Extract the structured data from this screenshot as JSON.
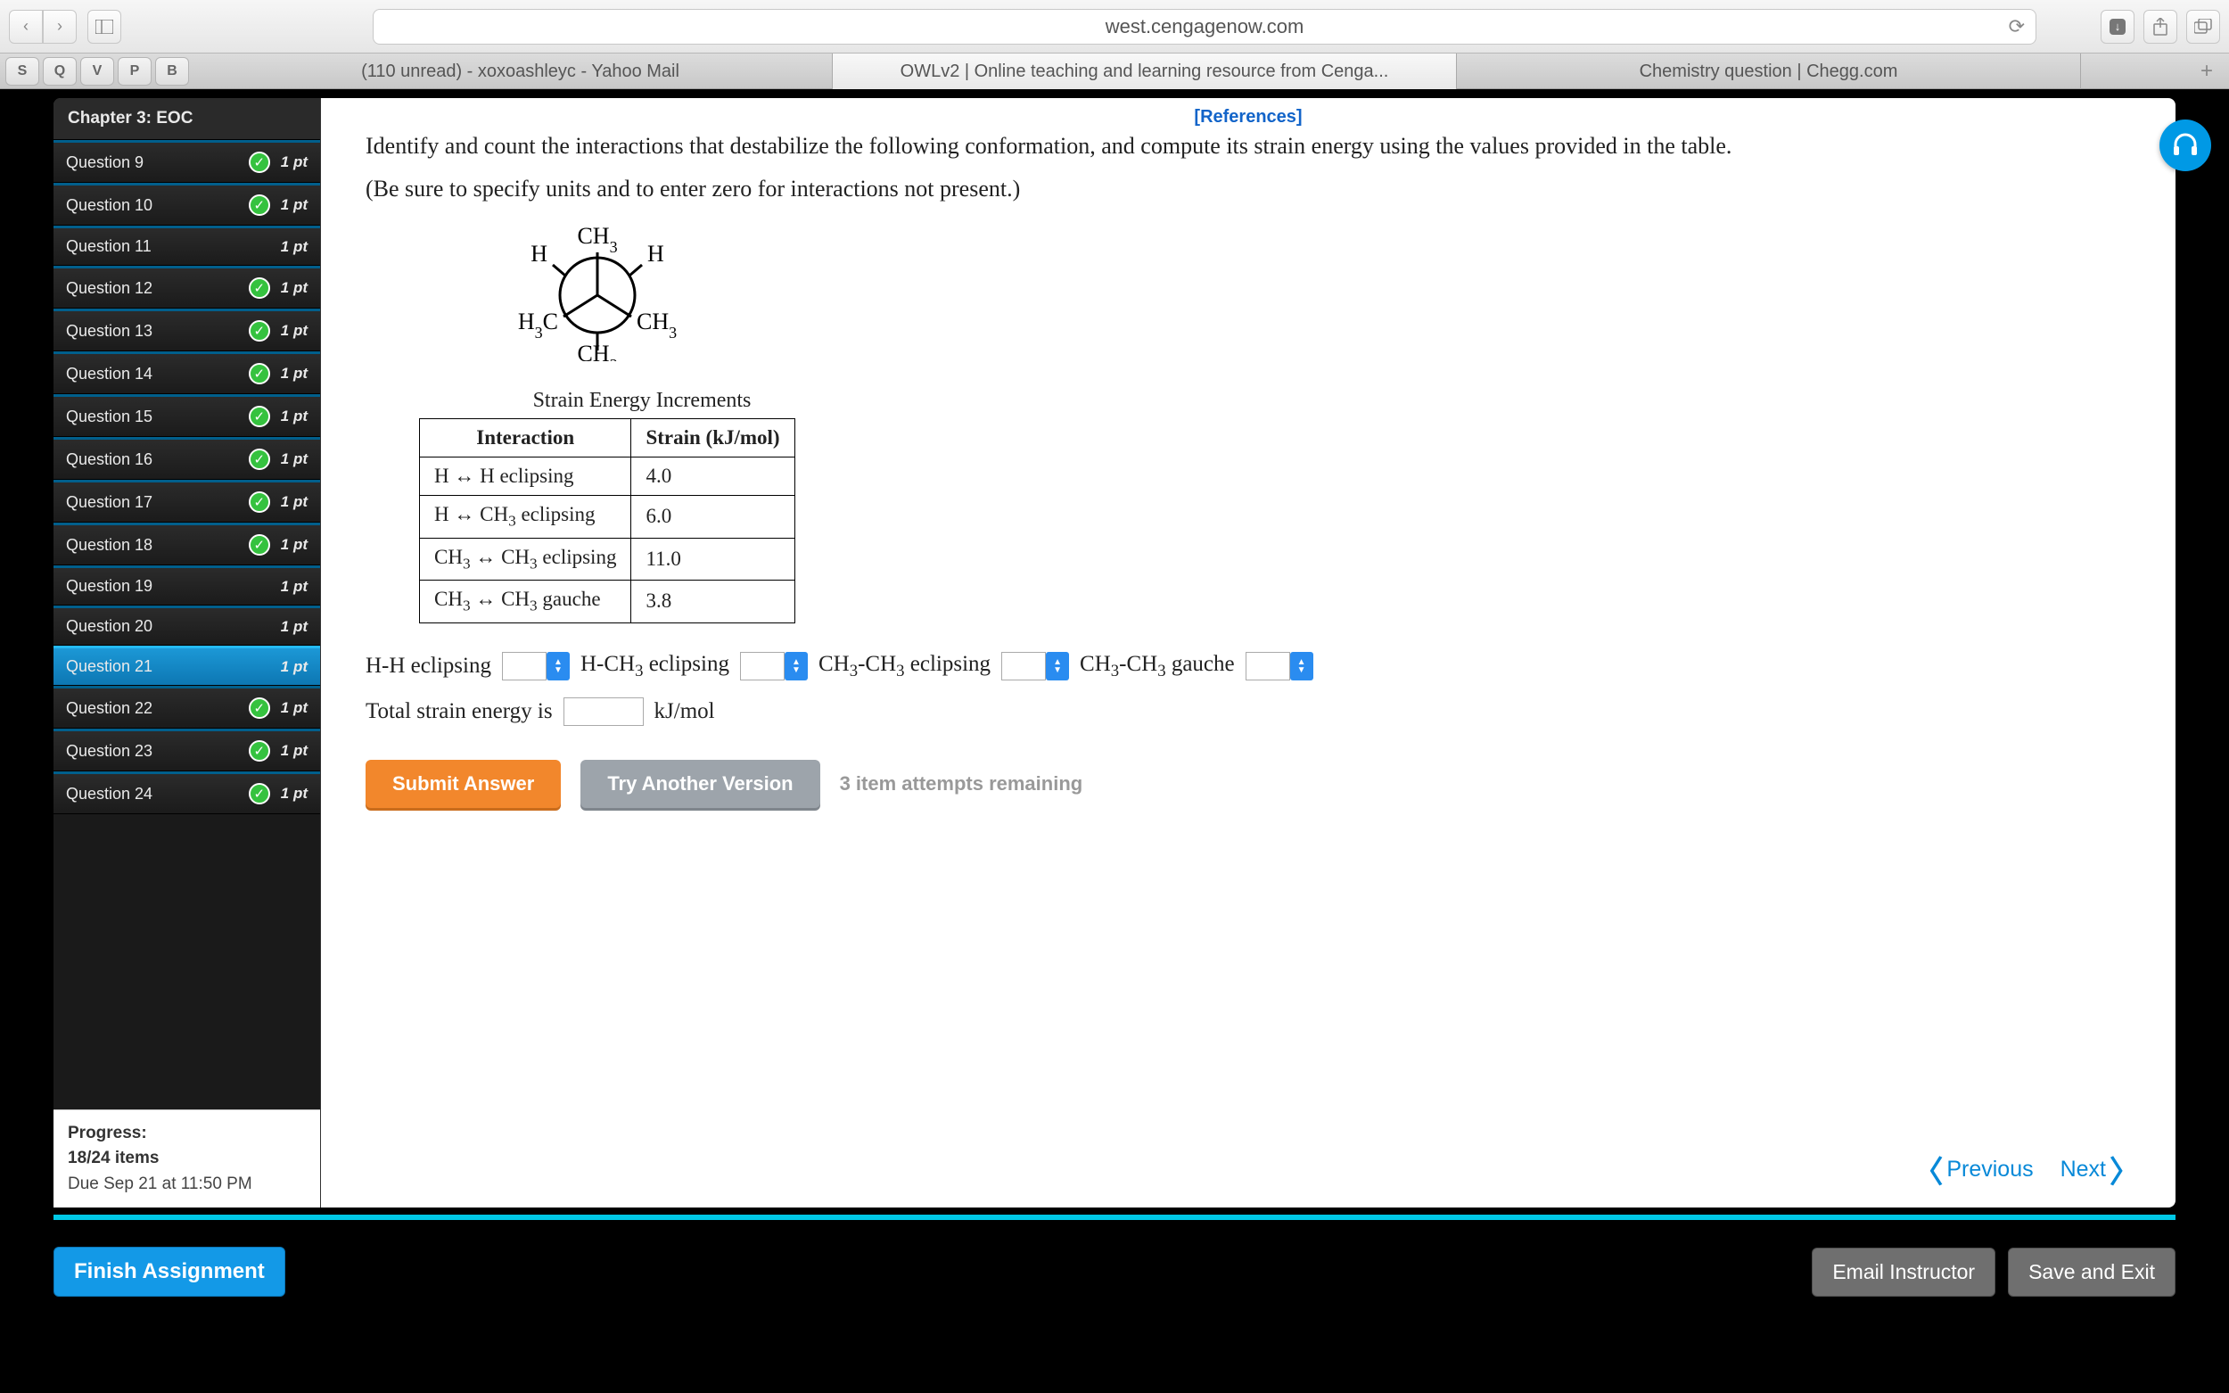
{
  "browser": {
    "url": "west.cengagenow.com",
    "favs": [
      "S",
      "Q",
      "V",
      "P",
      "B"
    ],
    "tabs": [
      "(110 unread) - xoxoashleyc - Yahoo Mail",
      "OWLv2 | Online teaching and learning resource from Cenga...",
      "Chemistry question | Chegg.com"
    ],
    "active_tab": 1
  },
  "sidebar": {
    "chapter": "Chapter 3: EOC",
    "questions": [
      {
        "label": "Question 9",
        "pts": "1 pt",
        "done": true
      },
      {
        "label": "Question 10",
        "pts": "1 pt",
        "done": true
      },
      {
        "label": "Question 11",
        "pts": "1 pt",
        "done": false
      },
      {
        "label": "Question 12",
        "pts": "1 pt",
        "done": true
      },
      {
        "label": "Question 13",
        "pts": "1 pt",
        "done": true
      },
      {
        "label": "Question 14",
        "pts": "1 pt",
        "done": true
      },
      {
        "label": "Question 15",
        "pts": "1 pt",
        "done": true
      },
      {
        "label": "Question 16",
        "pts": "1 pt",
        "done": true
      },
      {
        "label": "Question 17",
        "pts": "1 pt",
        "done": true
      },
      {
        "label": "Question 18",
        "pts": "1 pt",
        "done": true
      },
      {
        "label": "Question 19",
        "pts": "1 pt",
        "done": false
      },
      {
        "label": "Question 20",
        "pts": "1 pt",
        "done": false
      },
      {
        "label": "Question 21",
        "pts": "1 pt",
        "done": false,
        "current": true
      },
      {
        "label": "Question 22",
        "pts": "1 pt",
        "done": true
      },
      {
        "label": "Question 23",
        "pts": "1 pt",
        "done": true
      },
      {
        "label": "Question 24",
        "pts": "1 pt",
        "done": true
      }
    ],
    "progress_label": "Progress:",
    "progress_value": "18/24 items",
    "due_label": "Due Sep 21 at 11:50 PM"
  },
  "refs": "[References]",
  "prompt1": "Identify and count the interactions that destabilize the following conformation, and compute its strain energy using the values provided in the table.",
  "prompt2": "(Be sure to specify units and to enter zero for interactions not present.)",
  "table_title": "Strain Energy Increments",
  "table": {
    "headers": [
      "Interaction",
      "Strain (kJ/mol)"
    ],
    "rows": [
      {
        "int": "H ↔ H eclipsing",
        "val": "4.0"
      },
      {
        "int": "H ↔ CH3 eclipsing",
        "val": "6.0",
        "sub": true
      },
      {
        "int": "CH3 ↔ CH3 eclipsing",
        "val": "11.0",
        "sub": true
      },
      {
        "int": "CH3 ↔ CH3 gauche",
        "val": "3.8",
        "sub": true
      }
    ]
  },
  "inputs": {
    "hh": "H-H eclipsing",
    "hch3": "H-CH3 eclipsing",
    "ch3ch3e": "CH3-CH3 eclipsing",
    "ch3ch3g": "CH3-CH3 gauche",
    "total_label": "Total strain energy is",
    "total_unit": "kJ/mol"
  },
  "buttons": {
    "submit": "Submit Answer",
    "try_another": "Try Another Version",
    "attempts": "3 item attempts remaining",
    "previous": "Previous",
    "next": "Next",
    "finish": "Finish Assignment",
    "email": "Email Instructor",
    "save_exit": "Save and Exit"
  }
}
